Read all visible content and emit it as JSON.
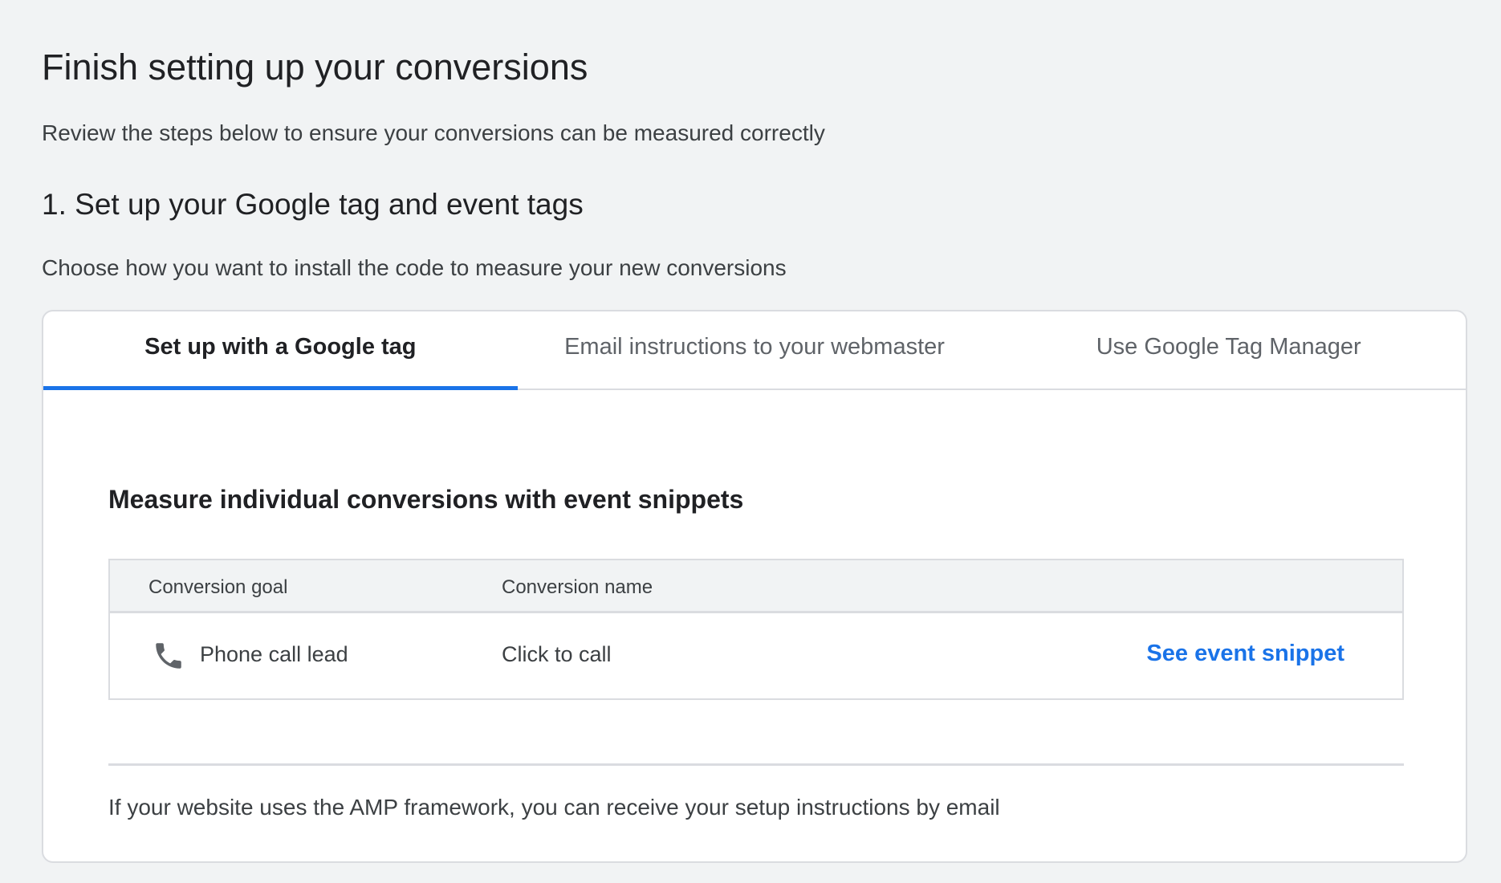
{
  "header": {
    "title": "Finish setting up your conversions",
    "subtitle": "Review the steps below to ensure your conversions can be measured correctly"
  },
  "step1": {
    "title": "1. Set up your Google tag and event tags",
    "description": "Choose how you want to install the code to measure your new conversions"
  },
  "tabs": [
    {
      "label": "Set up with a Google tag",
      "active": true
    },
    {
      "label": "Email instructions to your webmaster",
      "active": false
    },
    {
      "label": "Use Google Tag Manager",
      "active": false
    }
  ],
  "panel": {
    "section_title": "Measure individual conversions with event snippets",
    "table": {
      "columns": [
        "Conversion goal",
        "Conversion name"
      ],
      "rows": [
        {
          "icon": "phone-icon",
          "goal": "Phone call lead",
          "name": "Click to call",
          "action": "See event snippet"
        }
      ]
    },
    "amp_note": "If your website uses the AMP framework, you can receive your setup instructions by email"
  },
  "colors": {
    "background": "#f1f3f4",
    "accent": "#1a73e8",
    "border": "#dadce0",
    "text_primary": "#202124",
    "text_secondary": "#3c4043"
  }
}
